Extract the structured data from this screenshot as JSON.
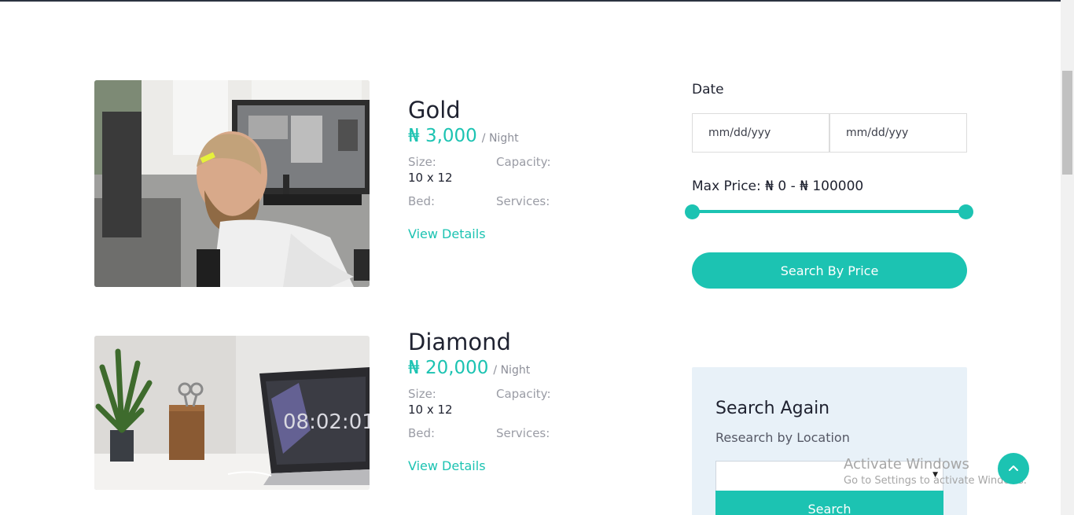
{
  "rooms": [
    {
      "name": "Gold",
      "price": "₦ 3,000",
      "per_night": "/ Night",
      "size_label": "Size:",
      "size_value": "10 x 12",
      "capacity_label": "Capacity:",
      "bed_label": "Bed:",
      "services_label": "Services:",
      "view_details": "View Details"
    },
    {
      "name": "Diamond",
      "price": "₦ 20,000",
      "per_night": "/ Night",
      "size_label": "Size:",
      "size_value": "10 x 12",
      "capacity_label": "Capacity:",
      "bed_label": "Bed:",
      "services_label": "Services:",
      "view_details": "View Details"
    }
  ],
  "filters": {
    "date_label": "Date",
    "date_from_placeholder": "mm/dd/yyy",
    "date_to_placeholder": "mm/dd/yyy",
    "max_price_label": "Max Price: ₦ 0 - ₦ 100000",
    "price_min": 0,
    "price_max": 100000,
    "search_by_price_label": "Search By Price"
  },
  "search_again": {
    "title": "Search Again",
    "subtitle": "Research by Location",
    "select_arrow": "▼",
    "search_label": "Search"
  },
  "watermark": {
    "title": "Activate Windows",
    "subtitle": "Go to Settings to activate Windows."
  },
  "icons": {
    "back_to_top": "chevron-up-icon"
  },
  "colors": {
    "accent": "#1cc3b2",
    "text": "#1f2230",
    "muted": "#9a9ca5",
    "panel": "#e8f1f8"
  }
}
